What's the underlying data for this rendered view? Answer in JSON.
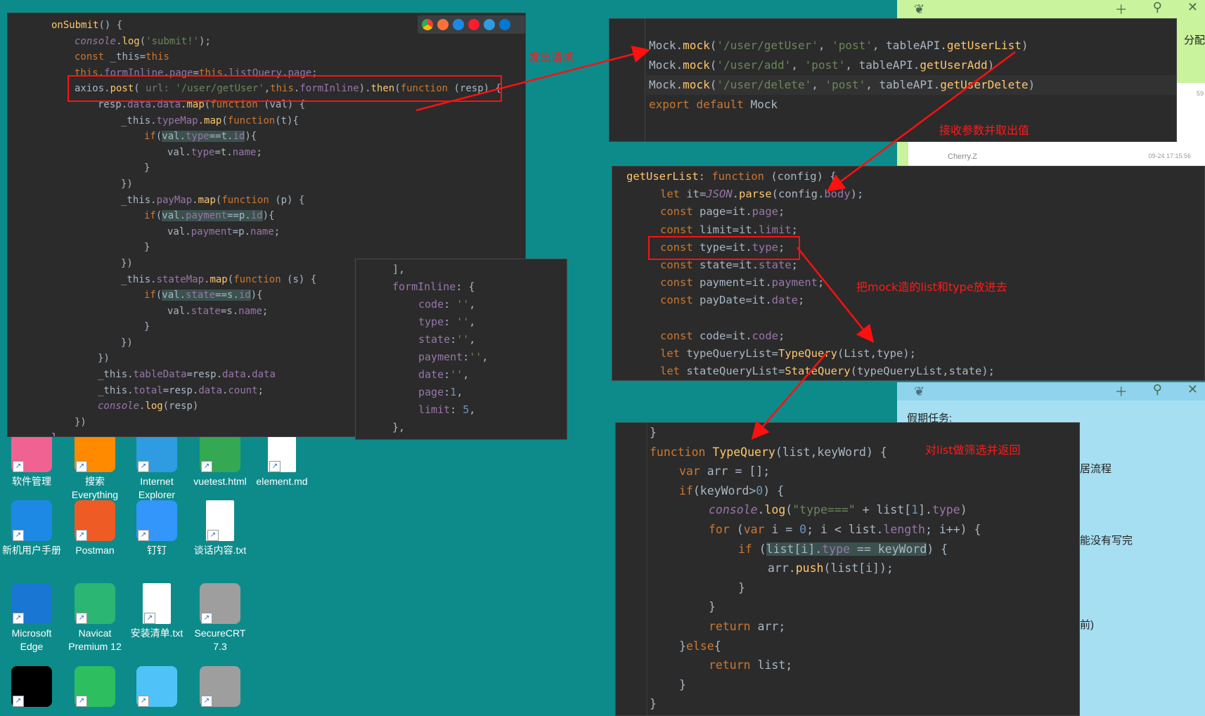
{
  "panel_top_left": {
    "lines": [
      {
        "indent": 0,
        "html": "<span class='fn'>onSubmit</span>() {"
      },
      {
        "indent": 1,
        "html": "<span class='it'>console</span>.<span class='fn'>log</span>(<span class='str'>'submit!'</span>);"
      },
      {
        "indent": 1,
        "html": "<span class='kw'>const</span> _this=<span class='kw'>this</span>"
      },
      {
        "indent": 1,
        "html": "<span class='kw'>this</span>.<span class='prop'>formInline</span>.<span class='prop'>page</span>=<span class='kw'>this</span>.<span class='prop'>listQuery</span>.<span class='prop'>page</span>;"
      },
      {
        "indent": 1,
        "html": "axios.<span class='fn'>post</span>( <span style='color:#787878'>url:</span> <span class='str'>'/user/getUser'</span>,<span class='kw'>this</span>.<span class='prop'>formInline</span>).<span class='fn'>then</span>(<span class='kw'>function</span> (resp) {"
      },
      {
        "indent": 2,
        "html": "resp.<span class='prop'>data</span>.<span class='prop'>data</span>.<span class='fn'>map</span>(<span class='kw'>function</span> (val) {"
      },
      {
        "indent": 3,
        "html": "_this.<span class='prop'>typeMap</span>.<span class='fn'>map</span>(<span class='kw'>function</span>(t){"
      },
      {
        "indent": 4,
        "html": "<span class='kw'>if</span>(<span class='hl'>val.<span class='prop'>type</span>==t.<span class='prop'>id</span></span>){"
      },
      {
        "indent": 5,
        "html": "val.<span class='prop'>type</span>=t.<span class='prop'>name</span>;"
      },
      {
        "indent": 4,
        "html": "}"
      },
      {
        "indent": 3,
        "html": "})"
      },
      {
        "indent": 3,
        "html": "_this.<span class='prop'>payMap</span>.<span class='fn'>map</span>(<span class='kw'>function</span> (p) {"
      },
      {
        "indent": 4,
        "html": "<span class='kw'>if</span>(<span class='hl'>val.<span class='prop'>payment</span>==p.<span class='prop'>id</span></span>){"
      },
      {
        "indent": 5,
        "html": "val.<span class='prop'>payment</span>=p.<span class='prop'>name</span>;"
      },
      {
        "indent": 4,
        "html": "}"
      },
      {
        "indent": 3,
        "html": "})"
      },
      {
        "indent": 3,
        "html": "_this.<span class='prop'>stateMap</span>.<span class='fn'>map</span>(<span class='kw'>function</span> (s) {"
      },
      {
        "indent": 4,
        "html": "<span class='kw'>if</span>(<span class='hl'>val.<span class='prop'>state</span>==s.<span class='prop'>id</span></span>){"
      },
      {
        "indent": 5,
        "html": "val.<span class='prop'>state</span>=s.<span class='prop'>name</span>;"
      },
      {
        "indent": 4,
        "html": "}"
      },
      {
        "indent": 3,
        "html": "})"
      },
      {
        "indent": 2,
        "html": "})"
      },
      {
        "indent": 2,
        "html": "_this.<span class='prop'>tableData</span>=resp.<span class='prop'>data</span>.<span class='prop'>data</span>"
      },
      {
        "indent": 2,
        "html": "_this.<span class='prop'>total</span>=resp.<span class='prop'>data</span>.<span class='prop'>count</span>;"
      },
      {
        "indent": 2,
        "html": "<span class='it'>console</span>.<span class='fn'>log</span>(resp)"
      },
      {
        "indent": 1,
        "html": "})"
      },
      {
        "indent": 0,
        "html": "},"
      }
    ]
  },
  "panel_form_inline": {
    "lines": [
      {
        "indent": 0,
        "html": "],"
      },
      {
        "indent": 0,
        "html": "<span class='prop'>formInline</span>: {"
      },
      {
        "indent": 1,
        "html": "<span class='prop'>code</span>: <span class='str'>''</span>,"
      },
      {
        "indent": 1,
        "html": "<span class='prop'>type</span>: <span class='str'>''</span>,"
      },
      {
        "indent": 1,
        "html": "<span class='prop'>state</span>:<span class='str'>''</span>,"
      },
      {
        "indent": 1,
        "html": "<span class='prop'>payment</span>:<span class='str'>''</span>,"
      },
      {
        "indent": 1,
        "html": "<span class='prop'>date</span>:<span class='str'>''</span>,"
      },
      {
        "indent": 1,
        "html": "<span class='prop'>page</span>:<span class='num'>1</span>,"
      },
      {
        "indent": 1,
        "html": "<span class='prop'>limit</span>: <span class='num'>5</span>,"
      },
      {
        "indent": 0,
        "html": "},"
      }
    ]
  },
  "panel_mock": {
    "lines": [
      {
        "html": "Mock.<span class='fn'>mock</span>(<span class='str'>'/user/getUser'</span>, <span class='str'>'post'</span>, tableAPI.<span class='fn'>getUserList</span>)"
      },
      {
        "html": "Mock.<span class='fn'>mock</span>(<span class='str'>'/user/add'</span>, <span class='str'>'post'</span>, tableAPI.<span class='fn'>getUserAdd</span>)"
      },
      {
        "html": "Mock.<span class='fn'>mock</span>(<span class='str'>'/user/delete'</span>, <span class='str'>'post'</span>, tableAPI.<span class='fn'>getUserDelete</span>)"
      },
      {
        "html": "<span class='kw'>export default</span> Mock"
      }
    ]
  },
  "panel_get_user_list": {
    "lines": [
      {
        "indent": 0,
        "html": "<span class='fn'>getUserList</span>: <span class='kw'>function</span> (config) {"
      },
      {
        "indent": 1,
        "html": "<span class='kw'>let</span> it=<span class='it'>JSON</span>.<span class='fn'>parse</span>(config.<span class='prop'>body</span>);"
      },
      {
        "indent": 1,
        "html": "<span class='kw'>const</span> page=it.<span class='prop'>page</span>;"
      },
      {
        "indent": 1,
        "html": "<span class='kw'>const</span> limit=it.<span class='prop'>limit</span>;"
      },
      {
        "indent": 1,
        "html": "<span class='kw'>const</span> type=it.<span class='prop'>type</span>;"
      },
      {
        "indent": 1,
        "html": "<span class='kw'>const</span> state=it.<span class='prop'>state</span>;"
      },
      {
        "indent": 1,
        "html": "<span class='kw'>const</span> payment=it.<span class='prop'>payment</span>;"
      },
      {
        "indent": 1,
        "html": "<span class='kw'>const</span> payDate=it.<span class='prop'>date</span>;"
      },
      {
        "indent": 1,
        "html": ""
      },
      {
        "indent": 1,
        "html": "<span class='kw'>const</span> code=it.<span class='prop'>code</span>;"
      },
      {
        "indent": 1,
        "html": "<span class='kw'>let</span> typeQueryList=<span class='fn'>TypeQuery</span>(List,type);"
      },
      {
        "indent": 1,
        "html": "<span class='kw'>let</span> stateQueryList=<span class='fn'>StateQuery</span>(typeQueryList,state);"
      }
    ]
  },
  "panel_type_query": {
    "lines": [
      {
        "indent": 0,
        "html": "}"
      },
      {
        "indent": 0,
        "html": "<span class='kw'>function</span> <span class='fn'>TypeQuery</span>(list,keyWord) {"
      },
      {
        "indent": 1,
        "html": "<span class='kw'>var</span> arr = [];"
      },
      {
        "indent": 1,
        "html": "<span class='kw'>if</span>(keyWord&gt;<span class='num'>0</span>) {"
      },
      {
        "indent": 2,
        "html": "<span class='it'>console</span>.<span class='fn'>log</span>(<span class='str'>\"type===\"</span> + list[<span class='num'>1</span>].<span class='prop'>type</span>)"
      },
      {
        "indent": 2,
        "html": "<span class='kw'>for</span> (<span class='kw'>var</span> i = <span class='num'>0</span>; i &lt; list.<span class='prop'>length</span>; i++) {"
      },
      {
        "indent": 3,
        "html": "<span class='kw'>if</span> (<span class='hl'>list[i].<span class='prop'>type</span> == keyWord</span>) {"
      },
      {
        "indent": 4,
        "html": "arr.<span class='fn'>push</span>(list[i]);"
      },
      {
        "indent": 3,
        "html": "}"
      },
      {
        "indent": 2,
        "html": "}"
      },
      {
        "indent": 2,
        "html": "<span class='kw'>return</span> arr;"
      },
      {
        "indent": 1,
        "html": "}<span class='kw'>else</span>{"
      },
      {
        "indent": 2,
        "html": "<span class='kw'>return</span> list;"
      },
      {
        "indent": 1,
        "html": "}"
      },
      {
        "indent": 0,
        "html": "}"
      }
    ]
  },
  "annotations": {
    "send_request": "发出请求",
    "receive_params": "接收参数并取出值",
    "put_list_type": "把mock造的list和type放进去",
    "filter_return": "对list做筛选并返回"
  },
  "sticky_note_top": {
    "author": "Cherry.Z",
    "timestamp": "09-24 17:15:56",
    "right_text": "分配",
    "small_text": "59",
    "color": "#c9f39c"
  },
  "sticky_note_bottom": {
    "title": "假期任务:",
    "lines": [
      "居流程",
      "能没有写完",
      "前)"
    ],
    "color": "#a6dff2"
  },
  "desktop_icons": [
    {
      "label": "软件管理",
      "color": "#f06292"
    },
    {
      "label": "搜索\nEverything",
      "color": "#ff8a00"
    },
    {
      "label": "Internet\nExplorer",
      "color": "#2f9be0"
    },
    {
      "label": "vuetest.html",
      "color": "#34a853"
    },
    {
      "label": "element.md",
      "color": "#ffffff"
    },
    {
      "label": "新机用户手册",
      "color": "#1e88e5"
    },
    {
      "label": "Postman",
      "color": "#ef5b25"
    },
    {
      "label": "钉钉",
      "color": "#3296fa"
    },
    {
      "label": "谈话内容.txt",
      "color": "#ffffff"
    },
    {
      "label": "Microsoft\nEdge",
      "color": "#1976d2"
    },
    {
      "label": "Navicat\nPremium 12",
      "color": "#2bb673"
    },
    {
      "label": "安装清单.txt",
      "color": "#ffffff"
    },
    {
      "label": "SecureCRT\n7.3",
      "color": "#9e9e9e"
    },
    {
      "label": "",
      "color": "#000000"
    },
    {
      "label": "",
      "color": "#2dbe60"
    },
    {
      "label": "",
      "color": "#4fc3f7"
    },
    {
      "label": "",
      "color": "#9e9e9e"
    }
  ],
  "browser_icons": [
    "chrome-icon",
    "firefox-icon",
    "safari-icon",
    "opera-icon",
    "ie-icon",
    "edge-icon"
  ],
  "colors": {
    "desktop": "#0d8b8b",
    "editor_bg": "#2b2b2b",
    "annotation": "#ff1a1a"
  }
}
